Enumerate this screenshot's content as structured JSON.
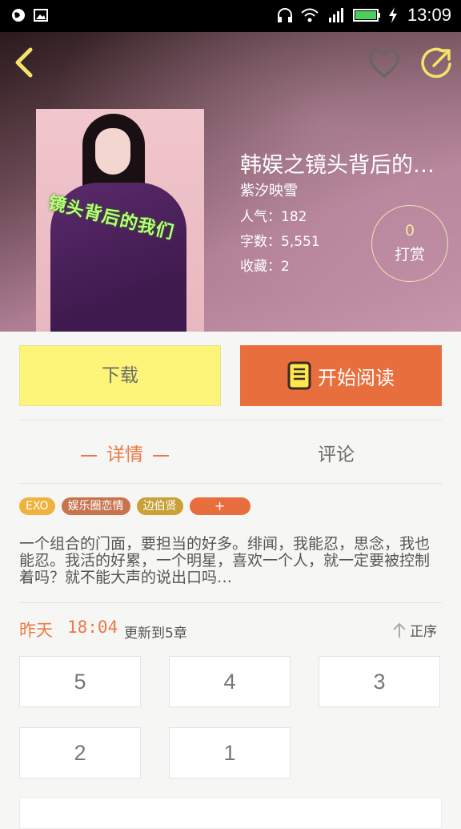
{
  "status_bar": {
    "time": "13:09"
  },
  "book": {
    "title": "韩娱之镜头背后的…",
    "cover_text": "镜头背后的我们",
    "author": "紫汐映雪",
    "popularity": "人气：182",
    "word_count": "字数：5,551",
    "favorites": "收藏：2",
    "tip_count": "0",
    "tip_label": "打赏"
  },
  "actions": {
    "download": "下载",
    "read": "开始阅读"
  },
  "tabs": {
    "details": "详情",
    "comments": "评论"
  },
  "tags": [
    "EXO",
    "娱乐圈恋情",
    "边伯贤",
    "+"
  ],
  "description": "一个组合的门面，要担当的好多。绯闻，我能忍，思念，我也能忍。我活的好累，一个明星，喜欢一个人，就一定要被控制着吗？就不能大声的说出口吗…",
  "update": {
    "day": "昨天",
    "time": "18:04",
    "info": "更新到5章",
    "sort": "正序"
  },
  "chapters": [
    "5",
    "4",
    "3",
    "2",
    "1"
  ],
  "colors": {
    "accent": "#e96e3d",
    "download_bg": "#fdf57a"
  }
}
